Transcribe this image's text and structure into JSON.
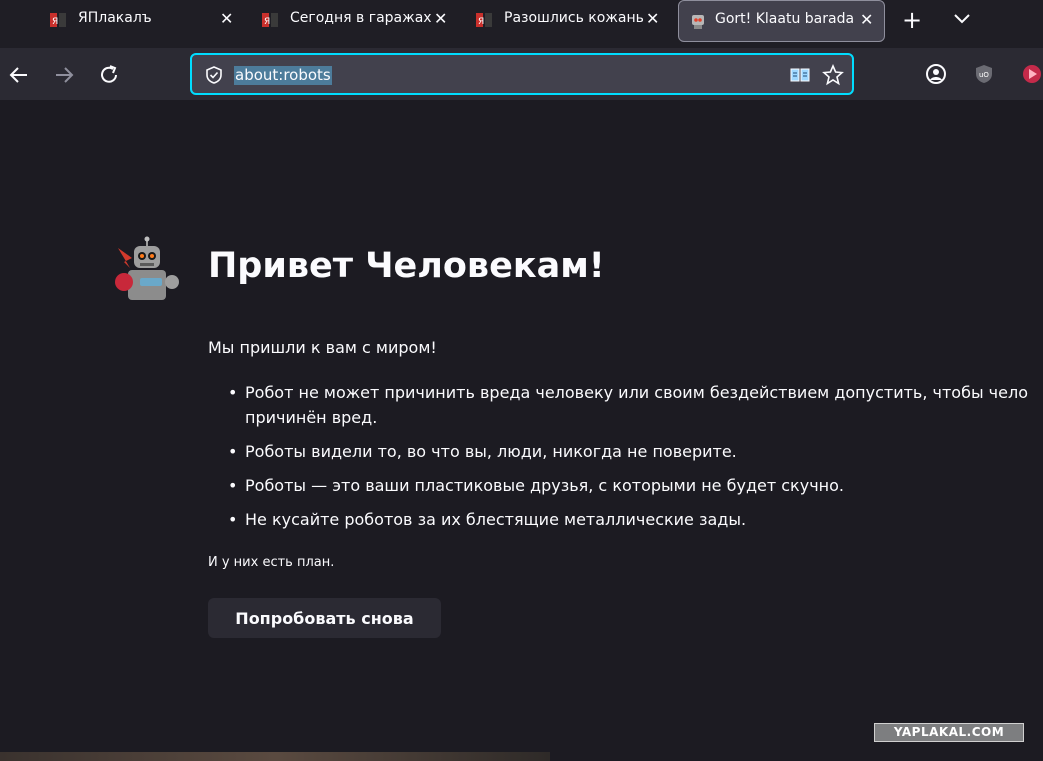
{
  "tabs": [
    {
      "title": "ЯПлакалъ",
      "active": false
    },
    {
      "title": "Сегодня в гаражах С",
      "active": false
    },
    {
      "title": "Разошлись кожаные",
      "active": false
    },
    {
      "title": "Gort! Klaatu barada n",
      "active": true
    }
  ],
  "urlbar": {
    "url": "about:robots"
  },
  "page": {
    "heading": "Привет Человекам!",
    "intro": "Мы пришли к вам с миром!",
    "laws": [
      "Робот не может причинить вреда человеку или своим бездействием допустить, чтобы чело",
      "причинён вред.",
      "Роботы видели то, во что вы, люди, никогда не поверите.",
      "Роботы — это ваши пластиковые друзья, с которыми не будет скучно.",
      "Не кусайте роботов за их блестящие металлические зады."
    ],
    "plan": "И у них есть план.",
    "retry_label": "Попробовать снова"
  },
  "watermark": "YAPLAKAL.COM",
  "colors": {
    "accent": "#00ddff",
    "background": "#1c1b22",
    "toolbar": "#2b2a33"
  }
}
